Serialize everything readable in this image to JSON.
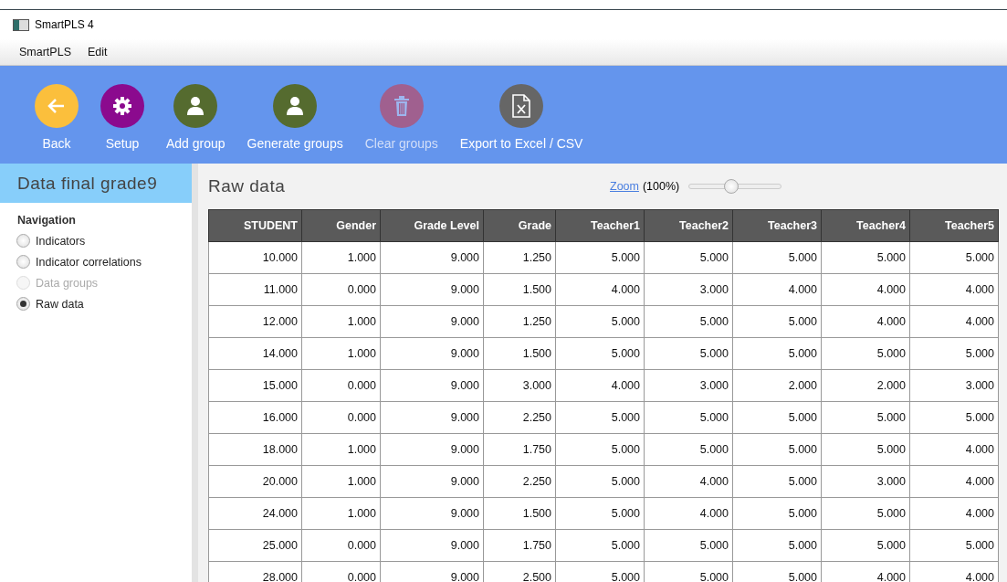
{
  "window": {
    "title": "SmartPLS 4"
  },
  "menu": [
    "SmartPLS",
    "Edit"
  ],
  "toolbar": [
    {
      "label": "Back",
      "kind": "back",
      "color": "#fbbf3c",
      "disabled": false
    },
    {
      "label": "Setup",
      "kind": "gear",
      "color": "#8b0a8e",
      "disabled": false
    },
    {
      "label": "Add group",
      "kind": "person",
      "color": "#556b2f",
      "disabled": false
    },
    {
      "label": "Generate groups",
      "kind": "person",
      "color": "#556b2f",
      "disabled": false
    },
    {
      "label": "Clear groups",
      "kind": "trash",
      "color": "#a0608f",
      "disabled": true
    },
    {
      "label": "Export to Excel / CSV",
      "kind": "excel",
      "color": "#666666",
      "disabled": false
    }
  ],
  "sidebar": {
    "title": "Data final grade9",
    "heading": "Navigation",
    "items": [
      {
        "label": "Indicators",
        "selected": false,
        "disabled": false
      },
      {
        "label": "Indicator correlations",
        "selected": false,
        "disabled": false
      },
      {
        "label": "Data groups",
        "selected": false,
        "disabled": true
      },
      {
        "label": "Raw data",
        "selected": true,
        "disabled": false
      }
    ]
  },
  "main": {
    "title": "Raw data",
    "zoom_link": "Zoom",
    "zoom_value": "(100%)",
    "zoom": {
      "level": 0.45
    }
  },
  "table": {
    "columns": [
      "STUDENT",
      "Gender",
      "Grade Level",
      "Grade",
      "Teacher1",
      "Teacher2",
      "Teacher3",
      "Teacher4",
      "Teacher5"
    ],
    "rows": [
      [
        "10.000",
        "1.000",
        "9.000",
        "1.250",
        "5.000",
        "5.000",
        "5.000",
        "5.000",
        "5.000"
      ],
      [
        "11.000",
        "0.000",
        "9.000",
        "1.500",
        "4.000",
        "3.000",
        "4.000",
        "4.000",
        "4.000"
      ],
      [
        "12.000",
        "1.000",
        "9.000",
        "1.250",
        "5.000",
        "5.000",
        "5.000",
        "4.000",
        "4.000"
      ],
      [
        "14.000",
        "1.000",
        "9.000",
        "1.500",
        "5.000",
        "5.000",
        "5.000",
        "5.000",
        "5.000"
      ],
      [
        "15.000",
        "0.000",
        "9.000",
        "3.000",
        "4.000",
        "3.000",
        "2.000",
        "2.000",
        "3.000"
      ],
      [
        "16.000",
        "0.000",
        "9.000",
        "2.250",
        "5.000",
        "5.000",
        "5.000",
        "5.000",
        "5.000"
      ],
      [
        "18.000",
        "1.000",
        "9.000",
        "1.750",
        "5.000",
        "5.000",
        "5.000",
        "5.000",
        "4.000"
      ],
      [
        "20.000",
        "1.000",
        "9.000",
        "2.250",
        "5.000",
        "4.000",
        "5.000",
        "3.000",
        "4.000"
      ],
      [
        "24.000",
        "1.000",
        "9.000",
        "1.500",
        "5.000",
        "4.000",
        "5.000",
        "5.000",
        "4.000"
      ],
      [
        "25.000",
        "0.000",
        "9.000",
        "1.750",
        "5.000",
        "5.000",
        "5.000",
        "5.000",
        "5.000"
      ],
      [
        "28.000",
        "0.000",
        "9.000",
        "2.500",
        "5.000",
        "5.000",
        "5.000",
        "4.000",
        "4.000"
      ]
    ]
  }
}
